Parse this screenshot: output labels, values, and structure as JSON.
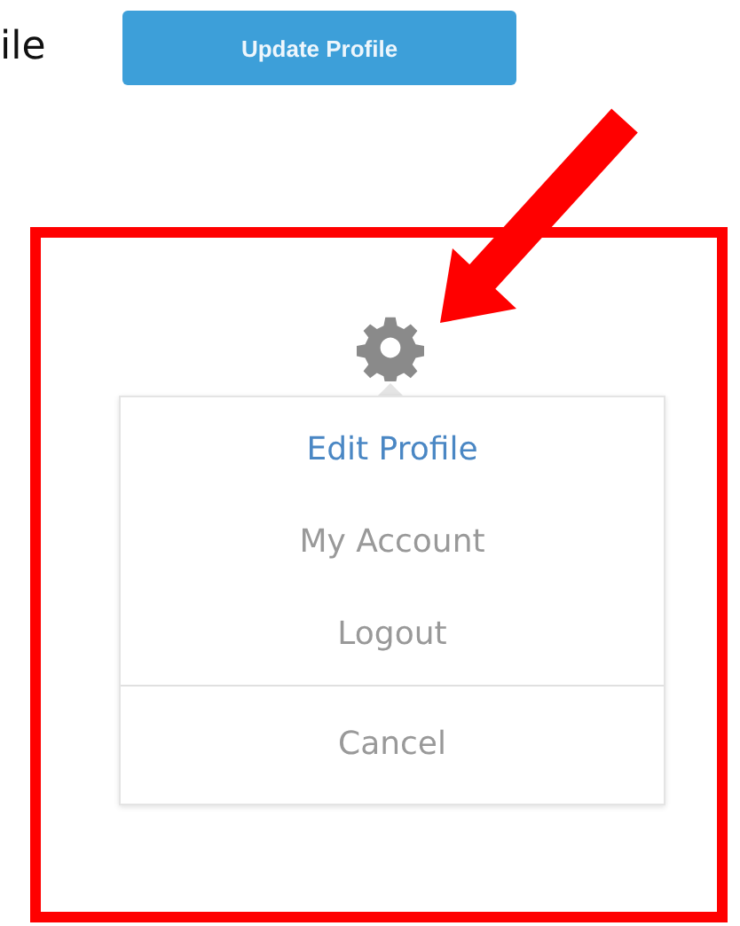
{
  "page_label": "ile",
  "update_button": "Update Profile",
  "menu": {
    "items": [
      {
        "label": "Edit Profile",
        "selected": true
      },
      {
        "label": "My Account",
        "selected": false
      },
      {
        "label": "Logout",
        "selected": false
      }
    ],
    "cancel": "Cancel"
  }
}
